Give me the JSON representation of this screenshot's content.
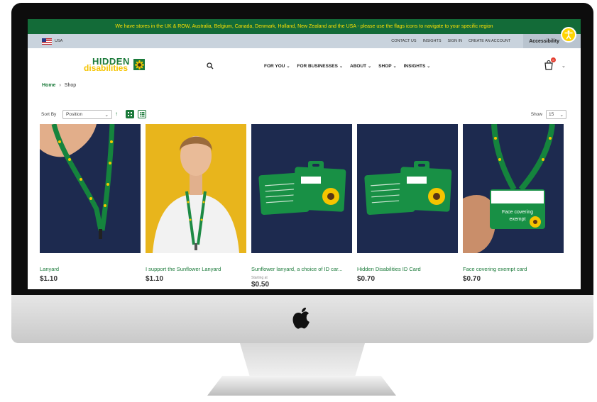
{
  "announcement": "We have stores in the UK & ROW, Australia, Belgium, Canada, Denmark, Holland, New Zealand and the USA - please use the flags icons to navigate to your specific region",
  "utility": {
    "region_label": "USA",
    "links": [
      "CONTACT US",
      "INSIGHTS",
      "SIGN IN",
      "CREATE AN ACCOUNT"
    ],
    "accessibility_label": "Accessibility"
  },
  "logo": {
    "top": "HIDDEN",
    "bottom": "disabilities"
  },
  "nav": [
    {
      "label": "FOR YOU"
    },
    {
      "label": "FOR BUSINESSES"
    },
    {
      "label": "ABOUT"
    },
    {
      "label": "SHOP"
    },
    {
      "label": "INSIGHTS"
    }
  ],
  "cart": {
    "count": "0"
  },
  "breadcrumb": {
    "home": "Home",
    "separator": "›",
    "current": "Shop"
  },
  "toolbar": {
    "sort_label": "Sort By",
    "sort_value": "Position",
    "show_label": "Show",
    "show_value": "15"
  },
  "products": [
    {
      "name": "Lanyard",
      "starting": "",
      "price": "$1.10"
    },
    {
      "name": "I support the Sunflower Lanyard",
      "starting": "",
      "price": "$1.10"
    },
    {
      "name": "Sunflower lanyard, a choice of ID car...",
      "starting": "Starting at",
      "price": "$0.50"
    },
    {
      "name": "Hidden Disabilities ID Card",
      "starting": "",
      "price": "$0.70"
    },
    {
      "name": "Face covering exempt card",
      "starting": "",
      "price": "$0.70"
    }
  ],
  "card_text": {
    "exempt_line1": "Face covering",
    "exempt_line2": "exempt"
  },
  "colors": {
    "brand_green": "#1b7a3a",
    "announce_green": "#136b38",
    "sunflower_yellow": "#f5c400",
    "navy": "#1d2a4f"
  }
}
